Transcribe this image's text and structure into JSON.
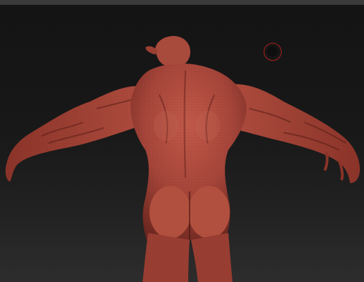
{
  "app": {
    "viewport_background": "#181818",
    "material_color": "#a8463a",
    "brush_cursor_color": "#b0201c"
  },
  "viewport": {
    "model_icon": "sculpted-humanoid-figure-back-view",
    "brush_icon": "brush-circle-cursor"
  }
}
